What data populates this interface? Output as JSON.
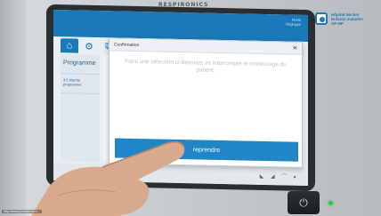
{
  "device": {
    "brand": "RESPIRONICS"
  },
  "logo": {
    "text": "Hôpital Necker\nEnfants malades\nAP-HP"
  },
  "screen": {
    "status_line": "Mode\nRéglages",
    "tabs": [
      {
        "icon": "home-icon",
        "glyph": "⌂",
        "active": true
      },
      {
        "icon": "gear-icon",
        "glyph": "⚙",
        "active": false
      },
      {
        "icon": "chart-icon",
        "glyph": "⧉",
        "active": false
      },
      {
        "icon": "stethoscope-icon",
        "glyph": "♧",
        "active": false
      }
    ],
    "sidebar": [
      {
        "label": "Programme"
      },
      {
        "label": "3/1 Alarme programmé"
      }
    ],
    "bottom_icons": "◣ ◢ ⌒ ▸"
  },
  "dialog": {
    "title": "Confirmation",
    "close": "×",
    "message": "Faire une sélection ci-dessous va interrompre le monitorage du patient.",
    "button_label": "reprendre"
  },
  "caption": "http://www.youtube.com/..."
}
